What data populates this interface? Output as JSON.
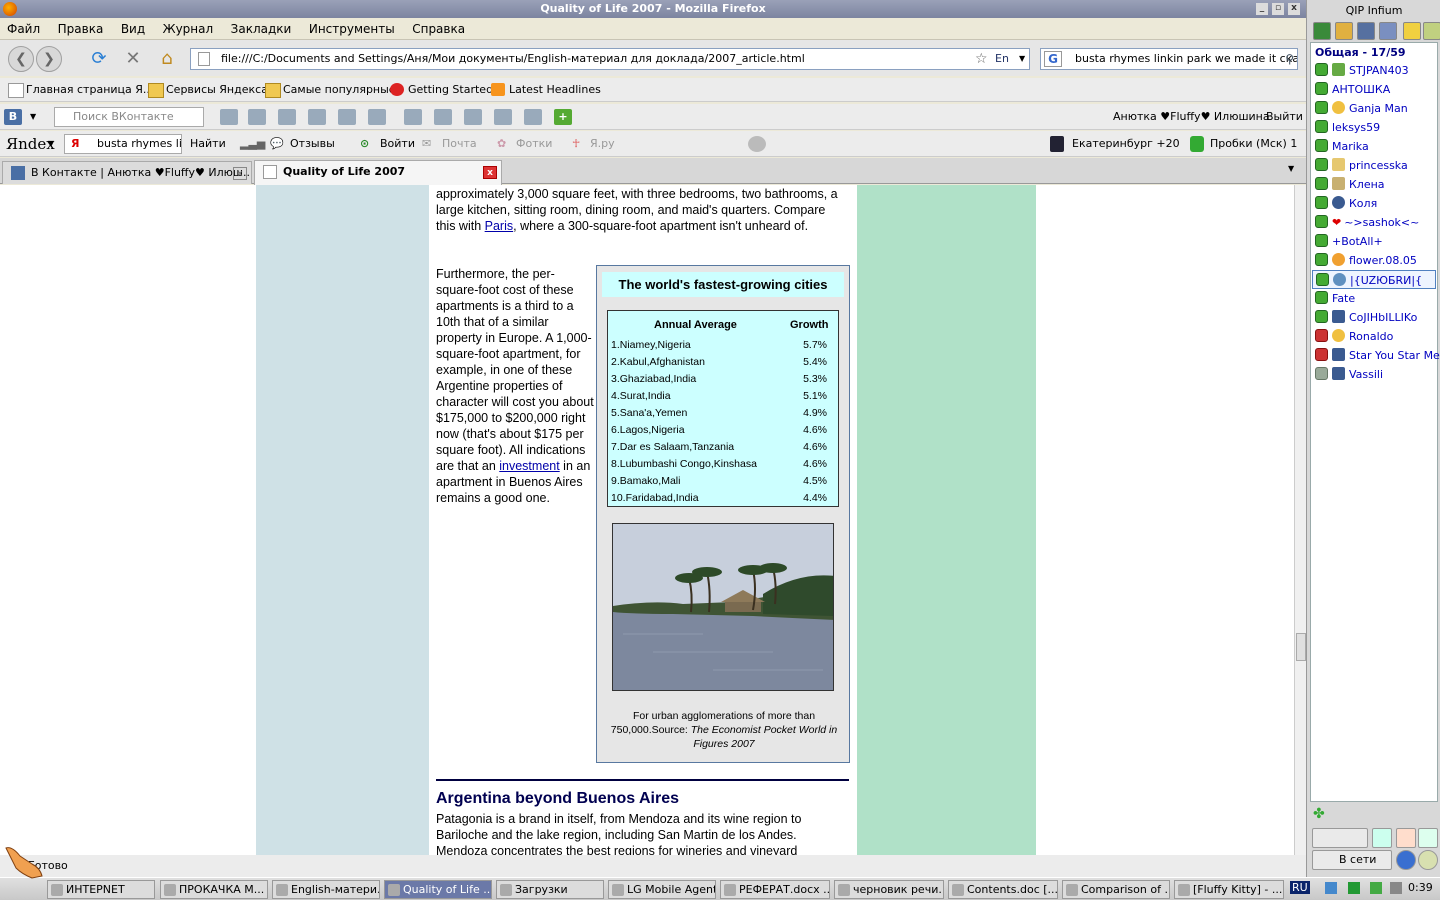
{
  "window_title": "Quality of Life 2007 - Mozilla Firefox",
  "menu": [
    "Файл",
    "Правка",
    "Вид",
    "Журнал",
    "Закладки",
    "Инструменты",
    "Справка"
  ],
  "nav": {
    "url": "file:///C:/Documents and Settings/Аня/Мои документы/English-материал для доклада/2007_article.html",
    "lang_badge": "En",
    "search_value": "busta rhymes linkin park we made it скача"
  },
  "bookmarks": [
    "Главная страница Я...",
    "Сервисы Яндекса",
    "Самые популярные",
    "Getting Started",
    "Latest Headlines"
  ],
  "vk_toolbar": {
    "search_placeholder": "Поиск ВКонтакте",
    "user": "Анютка ♥Fluffy♥ Илюшина",
    "logout": "Выйти"
  },
  "yandex_toolbar": {
    "logo": "Яndex",
    "query": "busta rhymes link",
    "find": "Найти",
    "reviews": "Отзывы",
    "login": "Войти",
    "mail": "Почта",
    "photos": "Фотки",
    "yaru": "Я.ру",
    "weather": "Екатеринбург +20",
    "traffic": "Пробки (Мск)  1"
  },
  "tabs": [
    {
      "label": "В Контакте | Анютка ♥Fluffy♥ Илюш...",
      "active": false
    },
    {
      "label": "Quality of Life 2007",
      "active": true
    }
  ],
  "article": {
    "p1_text": "approximately 3,000 square feet, with three bedrooms, two bathrooms, a large kitchen, sitting room, dining room, and maid's quarters. Compare this with ",
    "p1_link": "Paris",
    "p1_tail": ", where a 300-square-foot apartment isn't unheard of.",
    "p2_text": "Furthermore, the per-square-foot cost of these apartments is a third to a 10th that of a similar property in Europe. A 1,000-square-foot apartment, for example, in one of these Argentine properties of character will cost you about $175,000 to $200,000 right now (that's about $175 per square foot). All indications are that an ",
    "p2_link": "investment",
    "p2_tail": " in an apartment in Buenos Aires remains a good one.",
    "box": {
      "title": "The world's fastest-growing cities",
      "col1": "Annual Average",
      "col2": "Growth",
      "rows": [
        {
          "city": "1.Niamey,Nigeria",
          "growth": "5.7%"
        },
        {
          "city": "2.Kabul,Afghanistan",
          "growth": "5.4%"
        },
        {
          "city": "3.Ghaziabad,India",
          "growth": "5.3%"
        },
        {
          "city": "4.Surat,India",
          "growth": "5.1%"
        },
        {
          "city": "5.Sana'a,Yemen",
          "growth": "4.9%"
        },
        {
          "city": "6.Lagos,Nigeria",
          "growth": "4.6%"
        },
        {
          "city": "7.Dar es Salaam,Tanzania",
          "growth": "4.6%"
        },
        {
          "city": "8.Lubumbashi Congo,Kinshasa",
          "growth": "4.6%"
        },
        {
          "city": "9.Bamako,Mali",
          "growth": "4.5%"
        },
        {
          "city": "10.Faridabad,India",
          "growth": "4.4%"
        }
      ],
      "caption_plain": "For urban agglomerations of more than 750,000.Source: ",
      "caption_italic": "The Economist Pocket World in Figures 2007"
    },
    "heading": "Argentina beyond Buenos Aires",
    "p3": "Patagonia is a brand in itself, from Mendoza and its wine region to Bariloche and the lake region, including San Martin de los Andes. Mendoza concentrates the best regions for wineries and vineyard"
  },
  "status_text": "Готово",
  "taskbar": [
    "ИНТЕРNET",
    "ПРОКАЧКА М...",
    "English-матери...",
    "Quality of Life ...",
    "Загрузки",
    "LG Mobile Agent",
    "РЕФЕРАТ.docx ...",
    "черновик речи...",
    "Contents.doc [...",
    "Comparison of ...",
    "[Fluffy Kitty] - ..."
  ],
  "tray": {
    "lang": "RU",
    "clock": "0:39"
  },
  "qip": {
    "title": "QIP Infium",
    "group": "Общая - 17/59",
    "contacts": [
      "STJPAN403",
      "АНТОШКА",
      "Ganja Man",
      "leksys59",
      "Marika",
      "princesska",
      "Клена",
      "Коля",
      "~>sashok<~",
      "+BotAll+",
      "flower.08.05",
      "|{UZЮБRИ|{",
      "Fate",
      "CoJIHbILLIKo",
      "Ronaldo",
      "Star You Star Me",
      "Vassili"
    ],
    "status_button": "В сети"
  }
}
